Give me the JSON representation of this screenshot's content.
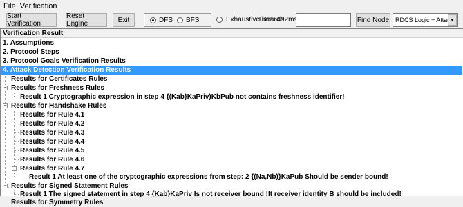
{
  "menu": [
    "File",
    "Verification"
  ],
  "toolbar": {
    "start": "Start Verification",
    "reset": "Reset Engine",
    "exit": "Exit",
    "dfs": "DFS",
    "bfs": "BFS",
    "exhaustive": "Exhaustive Search",
    "time": "Time: 492ms",
    "search_value": "",
    "find": "Find Node",
    "mode": "RDCS Logic + Attack De"
  },
  "tree": {
    "header": "Verification Result",
    "items": [
      "1. Assumptions",
      "2. Protocol Steps",
      "3. Protocol Goals Verification Results",
      "4. Attack Detection Verification Results",
      "Results for Certificates Rules",
      "Results for Freshness Rules",
      "Result 1  Cryptographic expression in step 4 {(Kab}KaPriv)KbPub  not contains freshness identifier!",
      "Results for Handshake Rules",
      "Results for Rule 4.1",
      "Results for Rule 4.2",
      "Results for Rule 4.3",
      "Results for Rule 4.4",
      "Results for Rule 4.5",
      "Results for Rule 4.6",
      "Results for Rule 4.7",
      "Result 1 At least one of the cryptographic expressions  from step: 2 {(Na,Nb)}KaPub Should be sender bound!",
      "Results for Signed Statement Rules",
      "Result 1 The signed statement in step 4 {Kab}KaPriv Is not receiver bound !It receiver identity B should be included!",
      "Results for Symmetry Rules"
    ]
  }
}
